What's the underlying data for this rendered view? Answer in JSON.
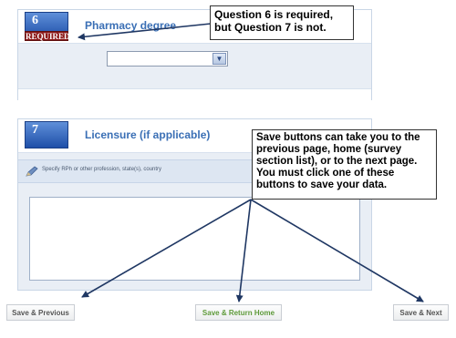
{
  "questions": [
    {
      "number": "6",
      "required_label": "REQUIRED",
      "title": "Pharmacy degree"
    },
    {
      "number": "7",
      "title": "Licensure (if applicable)",
      "hint": "Specify RPh or other profession, state(s), country"
    }
  ],
  "callouts": {
    "required_note": "Question 6 is required, but Question 7 is not.",
    "save_note": "Save buttons can take you to the previous page, home (survey section list), or to the next page. You must click one of these buttons to save your data."
  },
  "buttons": {
    "prev_label": "Save & Previous",
    "home_label": "Save & Return Home",
    "next_label": "Save & Next"
  },
  "icons": {
    "dropdown": "chevron-down-icon",
    "hint": "pencil-icon"
  },
  "colors": {
    "title_blue": "#3a6fb5",
    "badge_blue": "#1e4fa8",
    "required_red": "#8d1a1a",
    "home_button_green": "#5e9a3a",
    "arrow_navy": "#1f3763"
  }
}
